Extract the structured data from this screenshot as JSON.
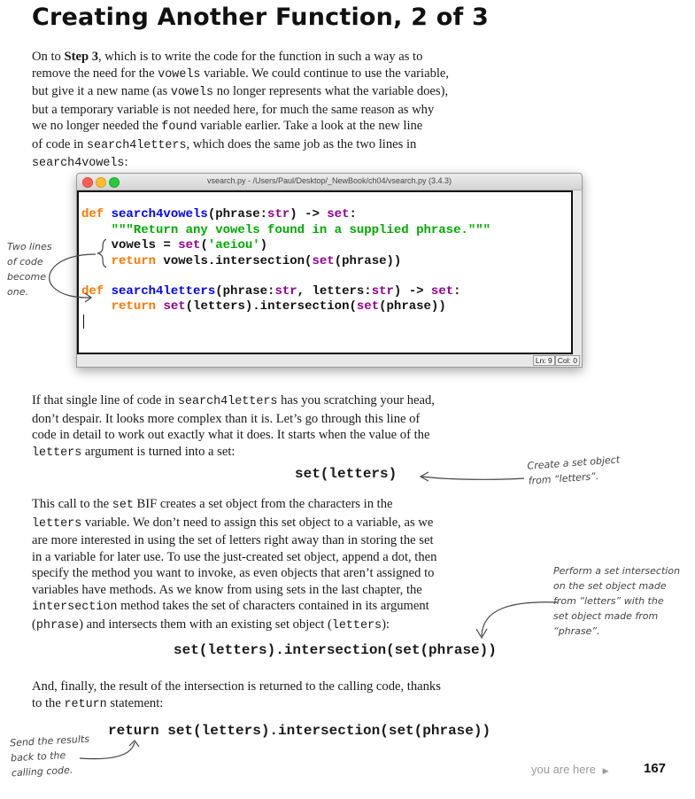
{
  "title": "Creating Another Function, 2 of 3",
  "intro": {
    "lines": [
      [
        {
          "t": "On to "
        },
        {
          "b": "Step 3"
        },
        {
          "t": ", which is to write the code for the function in such a way as to"
        }
      ],
      [
        {
          "t": "remove the need for the "
        },
        {
          "m": "vowels"
        },
        {
          "t": " variable. We could continue to use the variable,"
        }
      ],
      [
        {
          "t": "but give it a new name (as "
        },
        {
          "m": "vowels"
        },
        {
          "t": " no longer represents what the variable does),"
        }
      ],
      [
        {
          "t": "but a temporary variable is not needed here, for much the same reason as why"
        }
      ],
      [
        {
          "t": "we no longer needed the "
        },
        {
          "m": "found"
        },
        {
          "t": " variable earlier. Take a look at the new line"
        }
      ],
      [
        {
          "t": "of code in "
        },
        {
          "m": "search4letters"
        },
        {
          "t": ", which does the same job as the two lines in"
        }
      ],
      [
        {
          "m": "search4vowels"
        },
        {
          "t": ":"
        }
      ]
    ]
  },
  "editor": {
    "window_title": "vsearch.py - /Users/Paul/Desktop/_NewBook/ch04/vsearch.py (3.4.3)",
    "status_ln": "Ln: 9",
    "status_col": "Col: 0",
    "colors": {
      "keyword": "#ff7700",
      "function": "#0000ff",
      "builtin": "#900090",
      "string": "#00aa00"
    },
    "lines": [
      [
        {
          "c": "kw",
          "t": "def "
        },
        {
          "c": "fn",
          "t": "search4vowels"
        },
        {
          "t": "(phrase:"
        },
        {
          "c": "bi",
          "t": "str"
        },
        {
          "t": ") -> "
        },
        {
          "c": "bi",
          "t": "set"
        },
        {
          "t": ":"
        }
      ],
      [
        {
          "t": "    "
        },
        {
          "c": "st",
          "t": "\"\"\"Return any vowels found in a supplied phrase.\"\"\""
        }
      ],
      [
        {
          "t": "    vowels = "
        },
        {
          "c": "bi",
          "t": "set"
        },
        {
          "t": "("
        },
        {
          "c": "st",
          "t": "'aeiou'"
        },
        {
          "t": ")"
        }
      ],
      [
        {
          "t": "    "
        },
        {
          "c": "kw",
          "t": "return"
        },
        {
          "t": " vowels.intersection("
        },
        {
          "c": "bi",
          "t": "set"
        },
        {
          "t": "(phrase))"
        }
      ],
      [
        {
          "t": ""
        }
      ],
      [
        {
          "c": "kw",
          "t": "def "
        },
        {
          "c": "fn",
          "t": "search4letters"
        },
        {
          "t": "(phrase:"
        },
        {
          "c": "bi",
          "t": "str"
        },
        {
          "t": ", letters:"
        },
        {
          "c": "bi",
          "t": "str"
        },
        {
          "t": ") -> "
        },
        {
          "c": "bi",
          "t": "set"
        },
        {
          "t": ":"
        }
      ],
      [
        {
          "t": "    "
        },
        {
          "c": "kw",
          "t": "return"
        },
        {
          "t": " "
        },
        {
          "c": "bi",
          "t": "set"
        },
        {
          "t": "(letters).intersection("
        },
        {
          "c": "bi",
          "t": "set"
        },
        {
          "t": "(phrase))"
        }
      ]
    ]
  },
  "note_two_lines": [
    "Two lines",
    "of code",
    "become",
    "one."
  ],
  "para2": {
    "lines": [
      [
        {
          "t": "If that single line of code in "
        },
        {
          "m": "search4letters"
        },
        {
          "t": " has you scratching your head,"
        }
      ],
      [
        {
          "t": "don’t despair. It looks more complex than it is. Let’s go through this line of"
        }
      ],
      [
        {
          "t": "code in detail to work out exactly what it does. It starts when the value of the"
        }
      ],
      [
        {
          "m": "letters"
        },
        {
          "t": " argument is turned into a set:"
        }
      ]
    ]
  },
  "code1": "set(letters)",
  "note_create": [
    "Create a set object",
    "from “letters”."
  ],
  "para3": {
    "lines": [
      [
        {
          "t": "This call to the "
        },
        {
          "m": "set"
        },
        {
          "t": " BIF creates a set object from the characters in the"
        }
      ],
      [
        {
          "m": "letters"
        },
        {
          "t": " variable. We don’t need to assign this set object to a variable, as we"
        }
      ],
      [
        {
          "t": "are more interested in using the set of letters right away than in storing the set"
        }
      ],
      [
        {
          "t": "in a variable for later use. To use the just-created set object, append a dot, then"
        }
      ],
      [
        {
          "t": "specify the method you want to invoke, as even objects that aren’t assigned to"
        }
      ],
      [
        {
          "t": "variables have methods. As we know from using sets in the last chapter, the"
        }
      ],
      [
        {
          "m": "intersection"
        },
        {
          "t": " method takes the set of characters contained in its argument"
        }
      ],
      [
        {
          "t": "("
        },
        {
          "m": "phrase"
        },
        {
          "t": ") and intersects them with an existing set object ("
        },
        {
          "m": "letters"
        },
        {
          "t": "):"
        }
      ]
    ]
  },
  "note_perform": [
    "Perform a set intersection",
    "on the set object made",
    "from “letters” with the",
    "set object made from",
    "“phrase”."
  ],
  "code2": "set(letters).intersection(set(phrase))",
  "para4": {
    "lines": [
      [
        {
          "t": "And, finally, the result of the intersection is returned to the calling code,  thanks"
        }
      ],
      [
        {
          "t": "to the "
        },
        {
          "m": "return"
        },
        {
          "t": " statement:"
        }
      ]
    ]
  },
  "code3": "return set(letters).intersection(set(phrase))",
  "note_send": [
    "Send the results",
    "back to the",
    "calling code."
  ],
  "footer": {
    "you_are_here": "you are here",
    "page_number": "167"
  }
}
